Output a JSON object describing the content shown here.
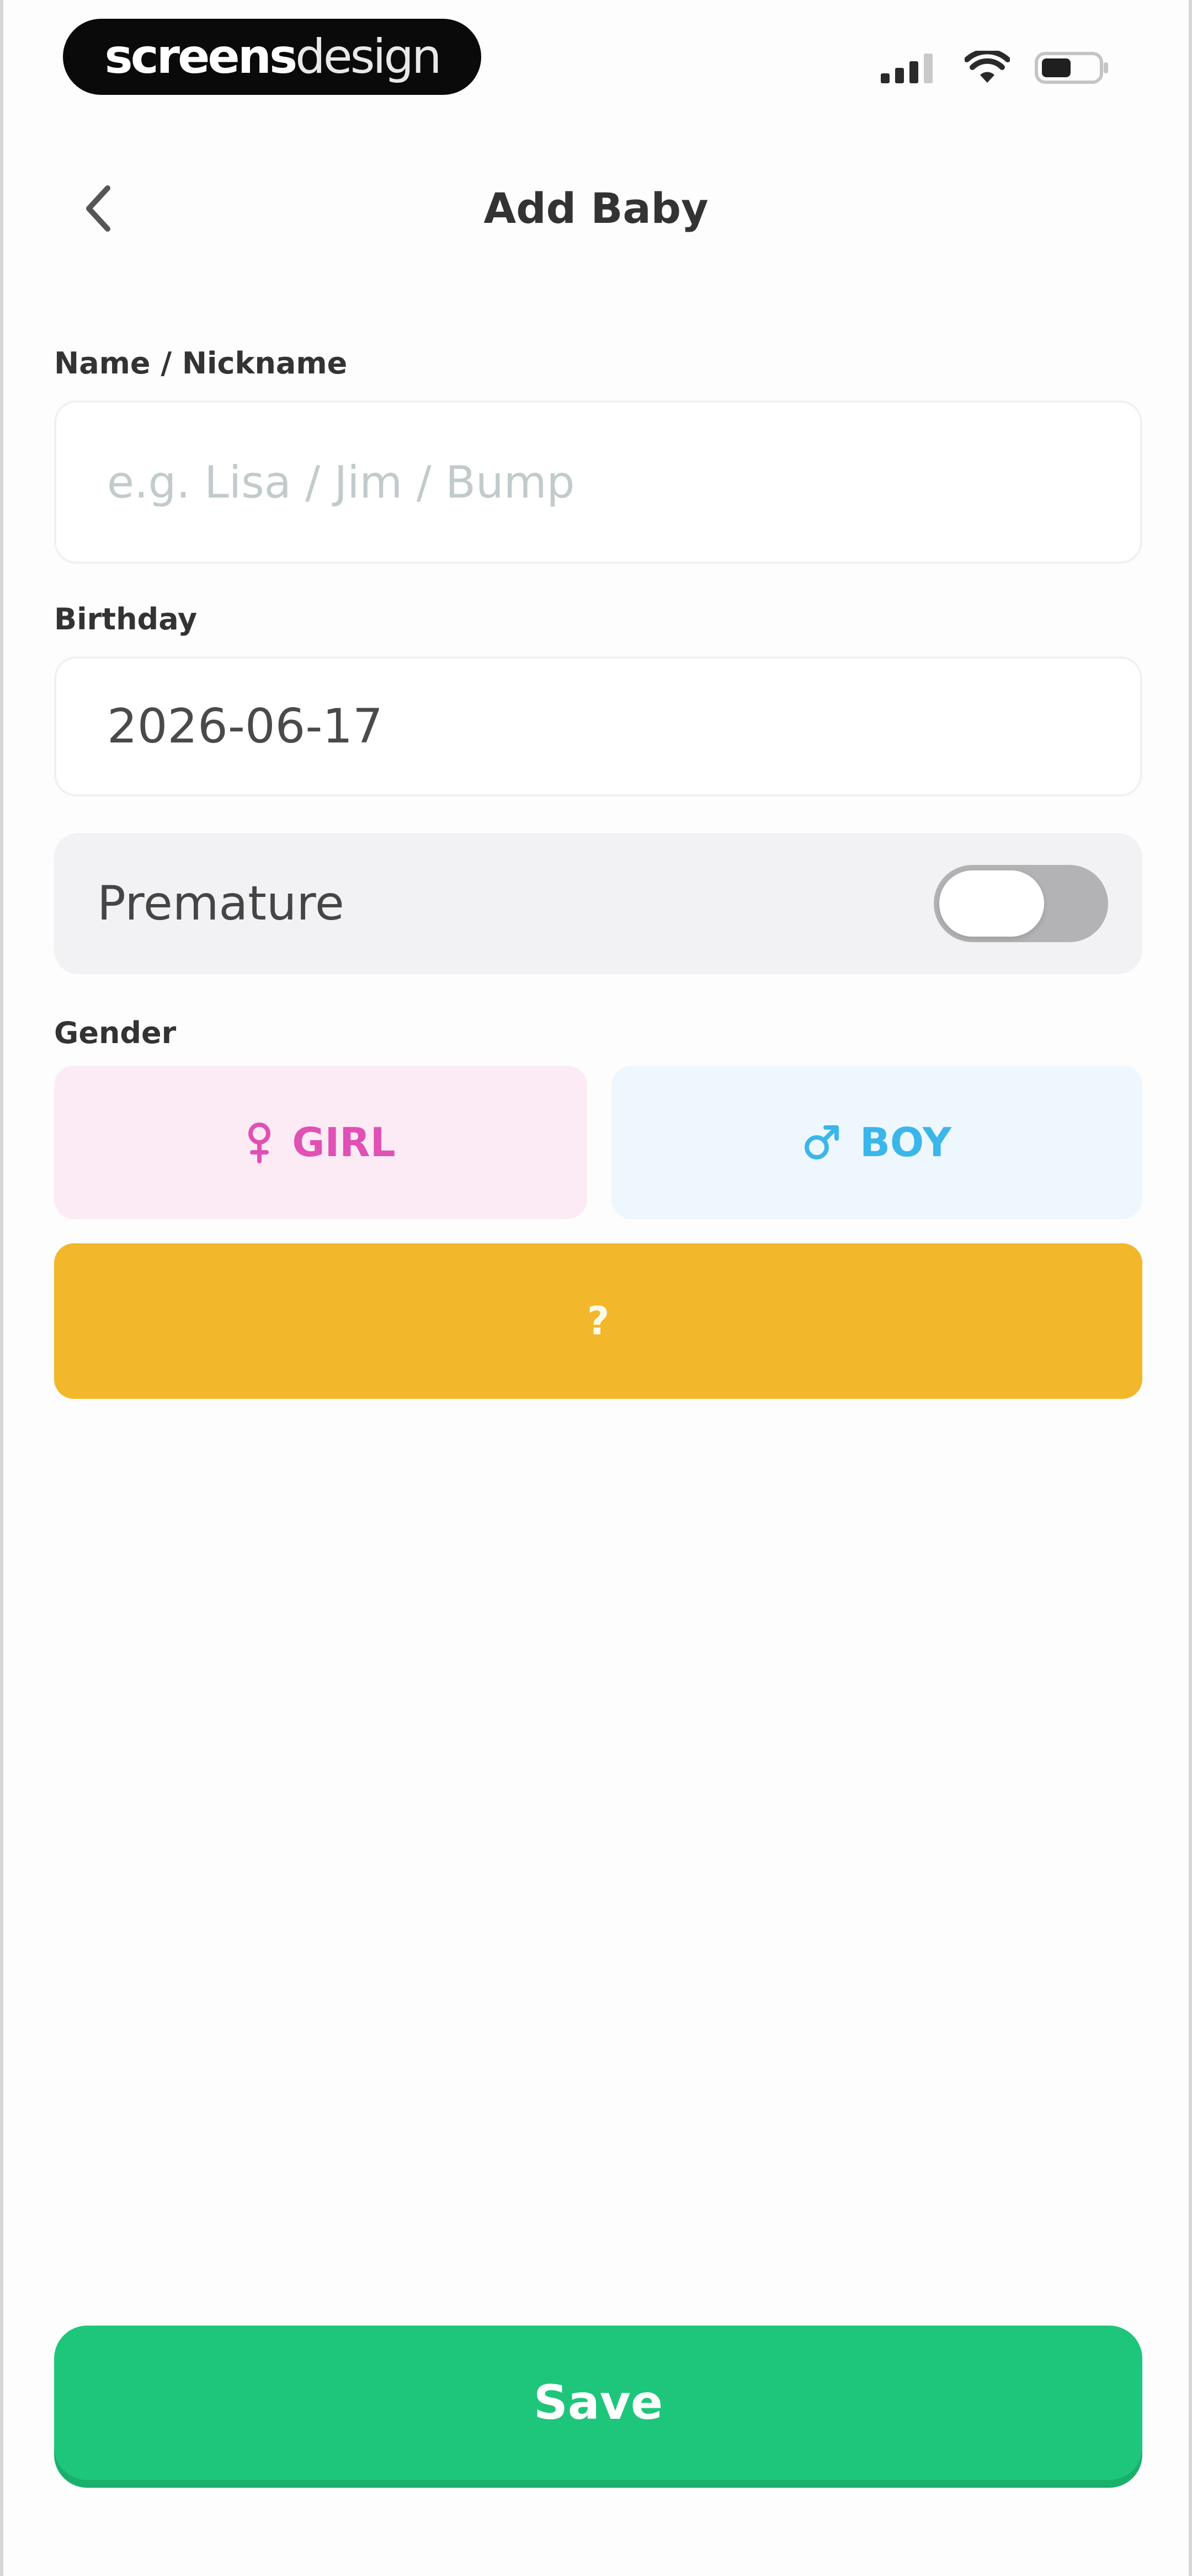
{
  "status_bar": {
    "brand_strong": "screens",
    "brand_light": "design"
  },
  "header": {
    "title": "Add Baby"
  },
  "form": {
    "name": {
      "label": "Name / Nickname",
      "placeholder": "e.g. Lisa / Jim / Bump",
      "value": ""
    },
    "birthday": {
      "label": "Birthday",
      "value": "2026-06-17"
    },
    "premature": {
      "label": "Premature",
      "enabled": false
    },
    "gender": {
      "label": "Gender",
      "options": [
        {
          "label": "GIRL",
          "icon": "female-symbol-icon",
          "color": "#e150b4",
          "background": "#fcebf5"
        },
        {
          "label": "BOY",
          "icon": "male-symbol-icon",
          "color": "#3ab6ea",
          "background": "#eef7fd"
        },
        {
          "label": "?",
          "icon": "",
          "color": "#fffbe8",
          "background": "#f2b72a"
        }
      ]
    }
  },
  "actions": {
    "save_label": "Save",
    "save_color": "#1ec67b"
  }
}
